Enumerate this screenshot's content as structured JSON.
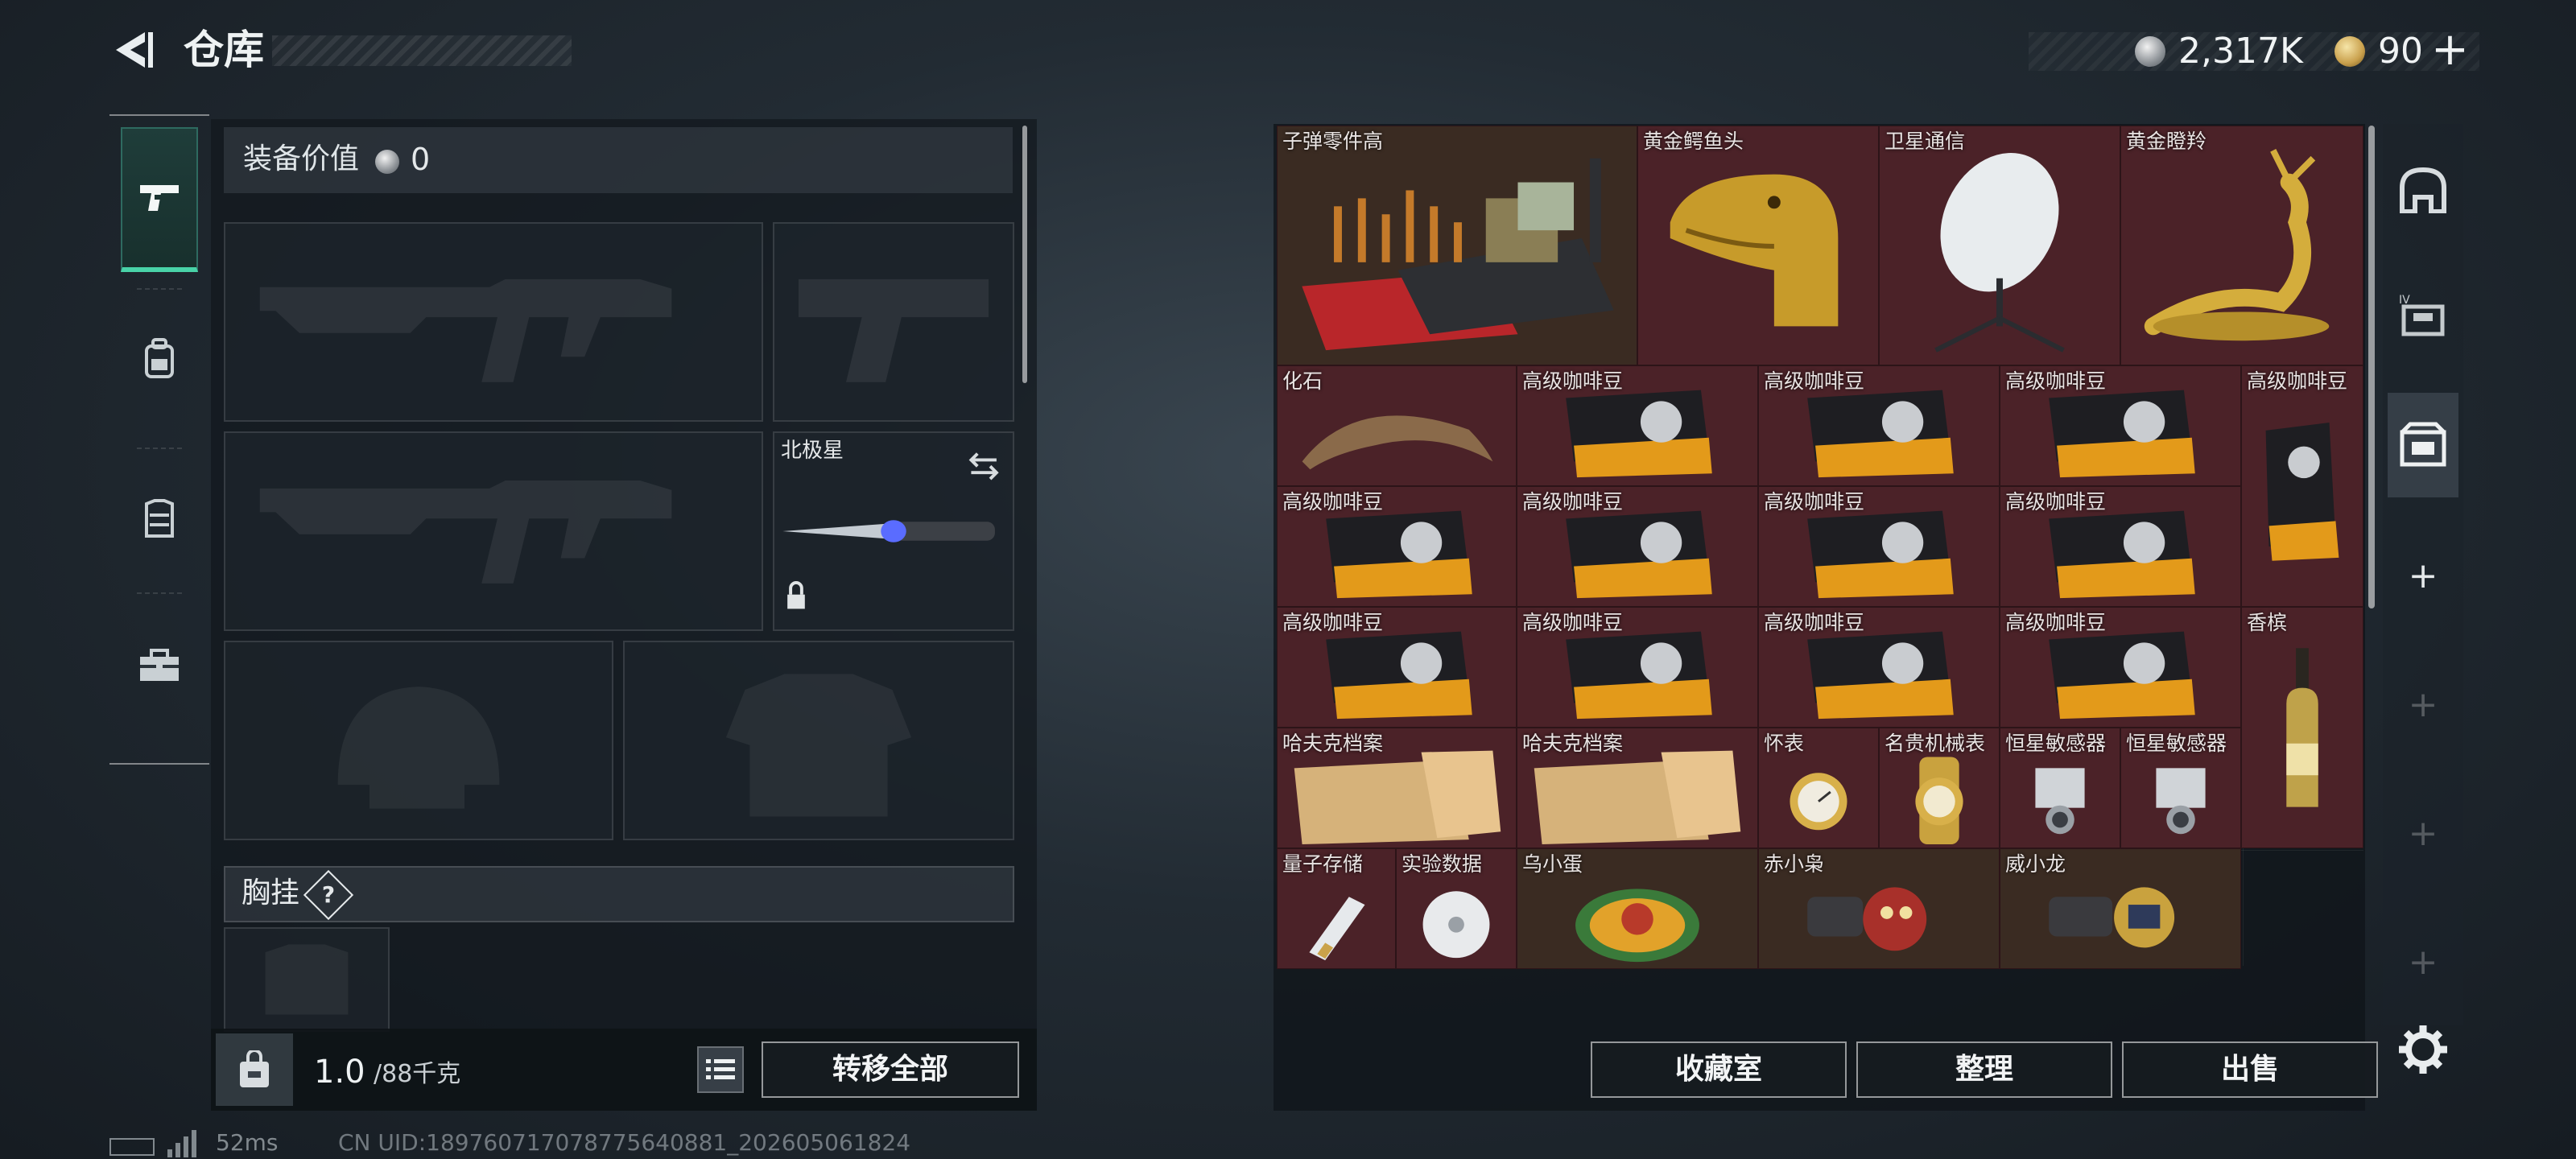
{
  "header": {
    "title": "仓库",
    "silver_amount": "2,317K",
    "gold_amount": "90",
    "plus": "+"
  },
  "left_tabs": [
    {
      "icon": "pistol-icon",
      "active": true
    },
    {
      "icon": "backpack-icon",
      "active": false
    },
    {
      "icon": "vest-icon",
      "active": false
    },
    {
      "icon": "toolbox-icon",
      "active": false
    }
  ],
  "equipment": {
    "value_label": "装备价值",
    "value_amount": "0",
    "knife_name": "北极星",
    "chest_rig_label": "胸挂",
    "help_symbol": "?"
  },
  "capacity": {
    "current": "1.0",
    "max": "/88千克",
    "transfer_all": "转移全部"
  },
  "storage": {
    "items": [
      {
        "label": "子弹零件高",
        "color": "brown",
        "icon": "ammo-parts-crate"
      },
      {
        "label": "黄金鳄鱼头",
        "color": "red",
        "icon": "golden-crocodile-head"
      },
      {
        "label": "卫星通信",
        "color": "red",
        "icon": "satellite-dish"
      },
      {
        "label": "黄金瞪羚",
        "color": "red",
        "icon": "golden-gazelle"
      },
      {
        "label": "化石",
        "color": "red",
        "icon": "fossil-claw"
      },
      {
        "label": "高级咖啡豆",
        "color": "red",
        "icon": "coffee-bag"
      },
      {
        "label": "高级咖啡豆",
        "color": "red",
        "icon": "coffee-bag"
      },
      {
        "label": "高级咖啡豆",
        "color": "red",
        "icon": "coffee-bag"
      },
      {
        "label": "高级咖啡豆",
        "color": "red",
        "icon": "coffee-bag-upright"
      },
      {
        "label": "高级咖啡豆",
        "color": "red",
        "icon": "coffee-bag"
      },
      {
        "label": "高级咖啡豆",
        "color": "red",
        "icon": "coffee-bag"
      },
      {
        "label": "高级咖啡豆",
        "color": "red",
        "icon": "coffee-bag"
      },
      {
        "label": "高级咖啡豆",
        "color": "red",
        "icon": "coffee-bag"
      },
      {
        "label": "高级咖啡豆",
        "color": "red",
        "icon": "coffee-bag"
      },
      {
        "label": "高级咖啡豆",
        "color": "red",
        "icon": "coffee-bag"
      },
      {
        "label": "高级咖啡豆",
        "color": "red",
        "icon": "coffee-bag"
      },
      {
        "label": "高级咖啡豆",
        "color": "red",
        "icon": "coffee-bag"
      },
      {
        "label": "香槟",
        "color": "red",
        "icon": "champagne-bottle"
      },
      {
        "label": "哈夫克档案",
        "color": "red",
        "icon": "file-folder"
      },
      {
        "label": "哈夫克档案",
        "color": "red",
        "icon": "file-folder"
      },
      {
        "label": "怀表",
        "color": "red",
        "icon": "pocket-watch"
      },
      {
        "label": "名贵机械表",
        "color": "red",
        "icon": "wrist-watch"
      },
      {
        "label": "恒星敏感器",
        "color": "red",
        "icon": "star-sensor"
      },
      {
        "label": "恒星敏感器",
        "color": "red",
        "icon": "star-sensor"
      },
      {
        "label": "量子存储",
        "color": "red",
        "icon": "quantum-drive"
      },
      {
        "label": "实验数据",
        "color": "red",
        "icon": "data-disc"
      },
      {
        "label": "乌小蛋",
        "color": "brown",
        "icon": "egg-ornament"
      },
      {
        "label": "赤小枭",
        "color": "brown",
        "icon": "owl-gauntlet"
      },
      {
        "label": "威小龙",
        "color": "brown",
        "icon": "dragon-gauntlet"
      }
    ]
  },
  "buttons": {
    "collection": "收藏室",
    "sort": "整理",
    "sell": "出售"
  },
  "status": {
    "ping": "52ms",
    "uid": "CN UID:18976071707877564088​1_202605061824"
  },
  "colors": {
    "accent": "#49d3a8",
    "cell_red": "#4b2228",
    "cell_brown": "#3a2b22"
  }
}
